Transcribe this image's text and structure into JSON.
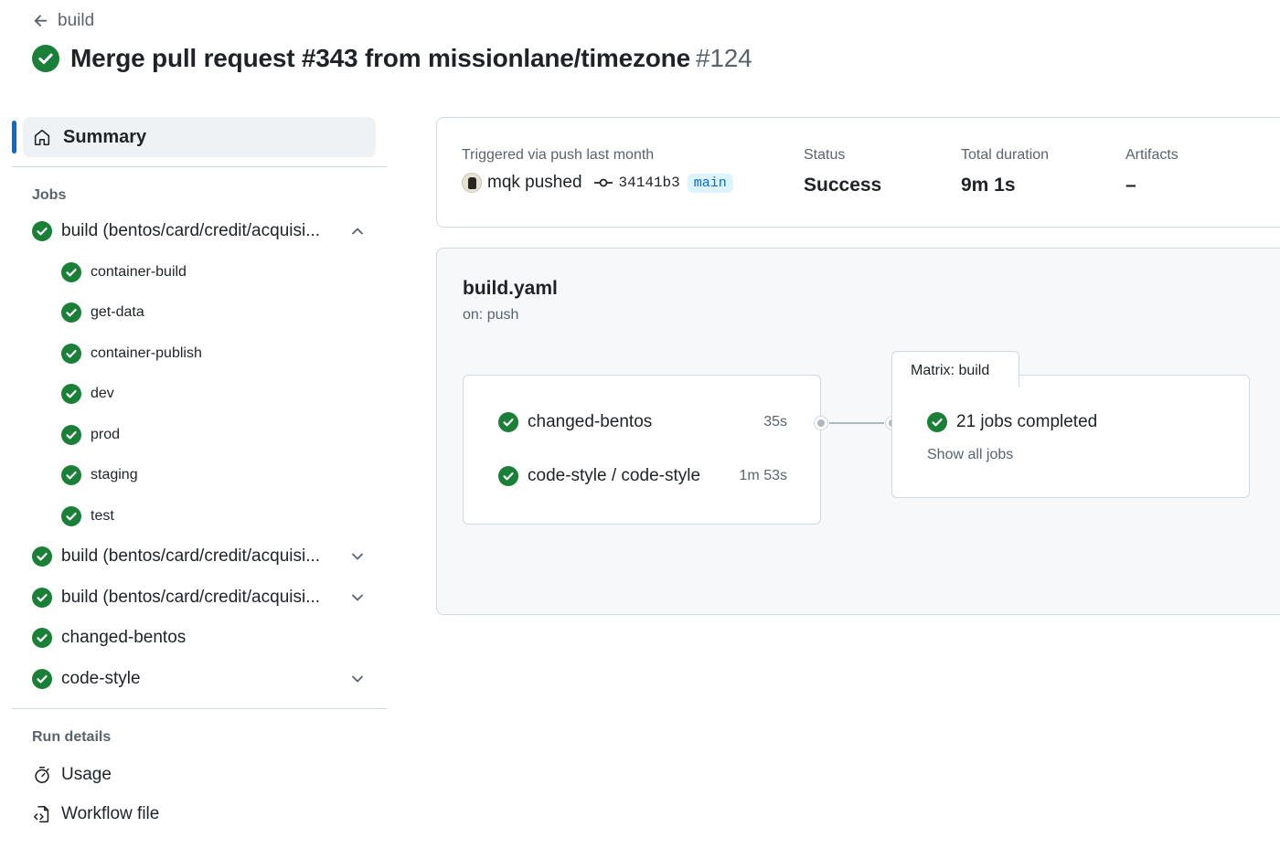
{
  "header": {
    "back_label": "build",
    "title": "Merge pull request #343 from missionlane/timezone",
    "run_number": "#124"
  },
  "sidebar": {
    "summary_label": "Summary",
    "jobs_heading": "Jobs",
    "jobs": [
      {
        "label": "build (bentos/card/credit/acquisi...",
        "expanded": true,
        "children": [
          "container-build",
          "get-data",
          "container-publish",
          "dev",
          "prod",
          "staging",
          "test"
        ]
      },
      {
        "label": "build (bentos/card/credit/acquisi...",
        "expanded": false
      },
      {
        "label": "build (bentos/card/credit/acquisi...",
        "expanded": false
      },
      {
        "label": "changed-bentos"
      },
      {
        "label": "code-style",
        "expanded": false
      }
    ],
    "run_details_heading": "Run details",
    "run_details": [
      {
        "label": "Usage",
        "icon": "stopwatch-icon"
      },
      {
        "label": "Workflow file",
        "icon": "file-code-icon"
      }
    ]
  },
  "info": {
    "triggered_label": "Triggered via push last month",
    "pusher": "mqk pushed",
    "sha": "34141b3",
    "branch": "main",
    "status_label": "Status",
    "status_value": "Success",
    "duration_label": "Total duration",
    "duration_value": "9m 1s",
    "artifacts_label": "Artifacts",
    "artifacts_value": "–"
  },
  "graph": {
    "workflow_name": "build.yaml",
    "trigger": "on: push",
    "jobs": [
      {
        "name": "changed-bentos",
        "duration": "35s"
      },
      {
        "name": "code-style / code-style",
        "duration": "1m 53s"
      }
    ],
    "matrix": {
      "tab_label": "Matrix: build",
      "summary": "21 jobs completed",
      "show_all": "Show all jobs"
    }
  },
  "colors": {
    "success": "#1a7f37",
    "accent": "#0969da",
    "muted": "#59636e",
    "border": "#d1d9e0"
  }
}
